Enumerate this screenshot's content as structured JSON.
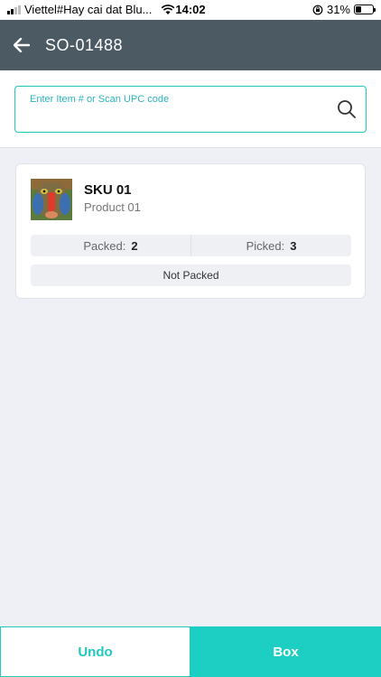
{
  "status_bar": {
    "carrier": "Viettel#Hay cai dat Blu...",
    "time": "14:02",
    "battery": "31%",
    "battery_level": 0.31,
    "icons": [
      "signal-icon",
      "wifi-icon",
      "orientation-lock-icon",
      "battery-icon"
    ]
  },
  "header": {
    "title": "SO-01488",
    "back_icon": "arrow-left-icon"
  },
  "search": {
    "placeholder": "Enter Item # or Scan UPC code",
    "value": "",
    "icon": "search-icon"
  },
  "items": [
    {
      "sku": "SKU 01",
      "product": "Product 01",
      "packed_label": "Packed:",
      "packed_value": "2",
      "picked_label": "Picked:",
      "picked_value": "3",
      "status": "Not Packed"
    }
  ],
  "footer": {
    "undo_label": "Undo",
    "box_label": "Box"
  },
  "colors": {
    "header_bg": "#4c5a63",
    "accent": "#1dcfc2",
    "background": "#eef0f5"
  }
}
